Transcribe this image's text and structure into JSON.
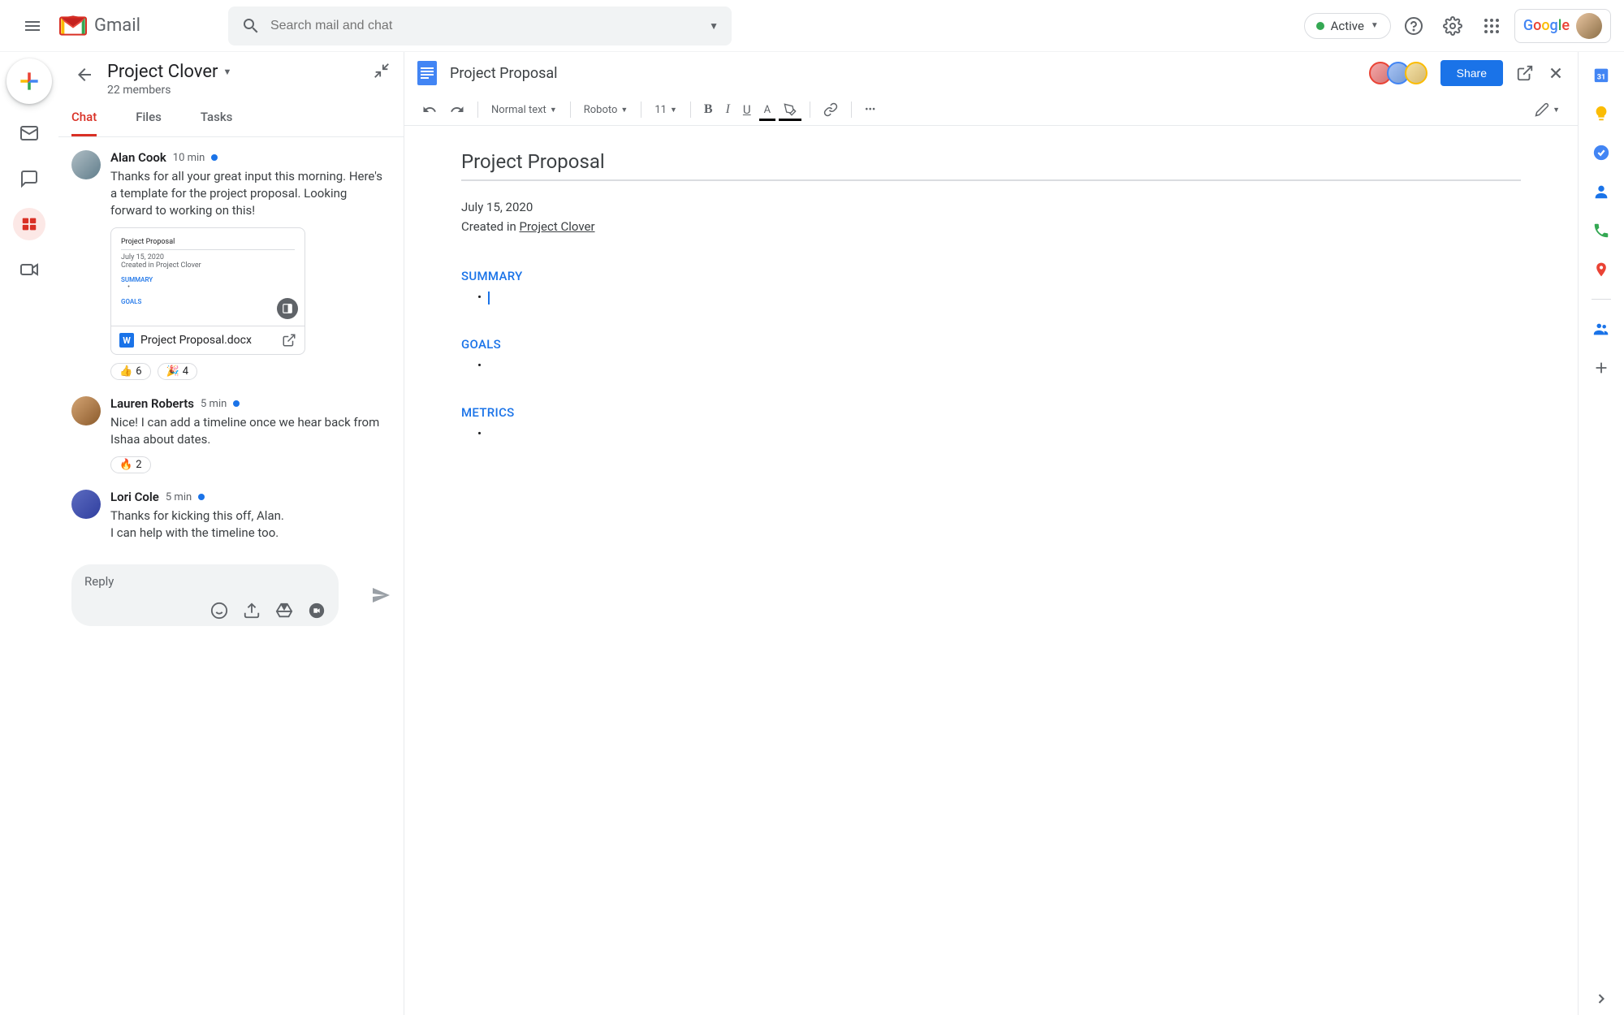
{
  "header": {
    "app_name": "Gmail",
    "search_placeholder": "Search mail and chat",
    "status": "Active"
  },
  "chat": {
    "room_name": "Project Clover",
    "member_count": "22 members",
    "tabs": [
      "Chat",
      "Files",
      "Tasks"
    ],
    "reply_placeholder": "Reply"
  },
  "messages": [
    {
      "author": "Alan Cook",
      "time": "10 min",
      "text": "Thanks for all your great input this morning. Here's a template for the project proposal. Looking forward to working on this!",
      "attachment": {
        "filename": "Project Proposal.docx",
        "preview_title": "Project Proposal",
        "preview_date": "July 15, 2020",
        "preview_created": "Created in Project Clover",
        "preview_sections": [
          "SUMMARY",
          "GOALS"
        ]
      },
      "reactions": [
        {
          "emoji": "👍",
          "count": "6"
        },
        {
          "emoji": "🎉",
          "count": "4"
        }
      ]
    },
    {
      "author": "Lauren Roberts",
      "time": "5 min",
      "text": "Nice! I can add a timeline once we hear back from Ishaa about dates.",
      "reactions": [
        {
          "emoji": "🔥",
          "count": "2"
        }
      ]
    },
    {
      "author": "Lori Cole",
      "time": "5 min",
      "text": "Thanks for kicking this off, Alan.\nI can help with the timeline too."
    }
  ],
  "doc": {
    "title": "Project Proposal",
    "share_label": "Share",
    "toolbar": {
      "style": "Normal text",
      "font": "Roboto",
      "size": "11"
    },
    "content": {
      "heading": "Project Proposal",
      "date": "July 15, 2020",
      "created_prefix": "Created in ",
      "created_link": "Project Clover",
      "sections": [
        "SUMMARY",
        "GOALS",
        "METRICS"
      ]
    }
  }
}
